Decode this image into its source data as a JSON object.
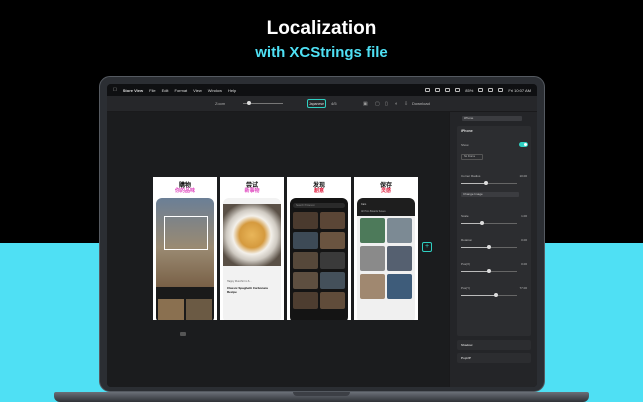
{
  "promo": {
    "headline": "Localization",
    "subheadline": "with XCStrings file"
  },
  "menubar": {
    "app_name": "Store View",
    "items": [
      "File",
      "Edit",
      "Format",
      "View",
      "Window",
      "Help"
    ],
    "battery": "85%",
    "clock": "Fri 10:07 AM"
  },
  "toolbar": {
    "zoom_label": "Zoom",
    "language": "Japanese",
    "count": "4/5",
    "download_label": "Download"
  },
  "screenshots": [
    {
      "title": "購物",
      "subtitle": "你的品味",
      "subtitle_color": "#e04ac0"
    },
    {
      "title": "尝试",
      "subtitle": "新事物",
      "subtitle_color": "#e04ac0",
      "caption": "Classic Spaghetti Carbonara Recipe",
      "subcaption": "Happy Munchin' is 6..."
    },
    {
      "title": "发现",
      "subtitle": "創意",
      "subtitle_color": "#e02040",
      "search_placeholder": "Search Pinterest"
    },
    {
      "title": "保存",
      "subtitle": "灵感",
      "subtitle_color": "#e02040",
      "board_title": "Cars",
      "tabs": "All Pins  Boards  Saves"
    }
  ],
  "inspector": {
    "device_select": "iPhone",
    "section_title": "iPhone",
    "show_label": "Show",
    "frame_button": "No Frame",
    "corner_radius_label": "Corner Radius",
    "corner_radius_value": "10.00",
    "corner_radius": 0.45,
    "change_image_label": "Change Image",
    "scale_label": "Scale",
    "scale_value": "1.00",
    "scale": 0.38,
    "rotation_label": "Rotation",
    "rotation_value": "0.00",
    "rotation": 0.5,
    "posx_label": "Pos(X)",
    "posx_value": "0.00",
    "posx": 0.5,
    "posy_label": "Pos(Y)",
    "posy_value": "77.00",
    "posy": 0.62,
    "shadow_label": "Shadow",
    "pop_up_label": "PopUP"
  },
  "accent_color": "#2fd0c2"
}
